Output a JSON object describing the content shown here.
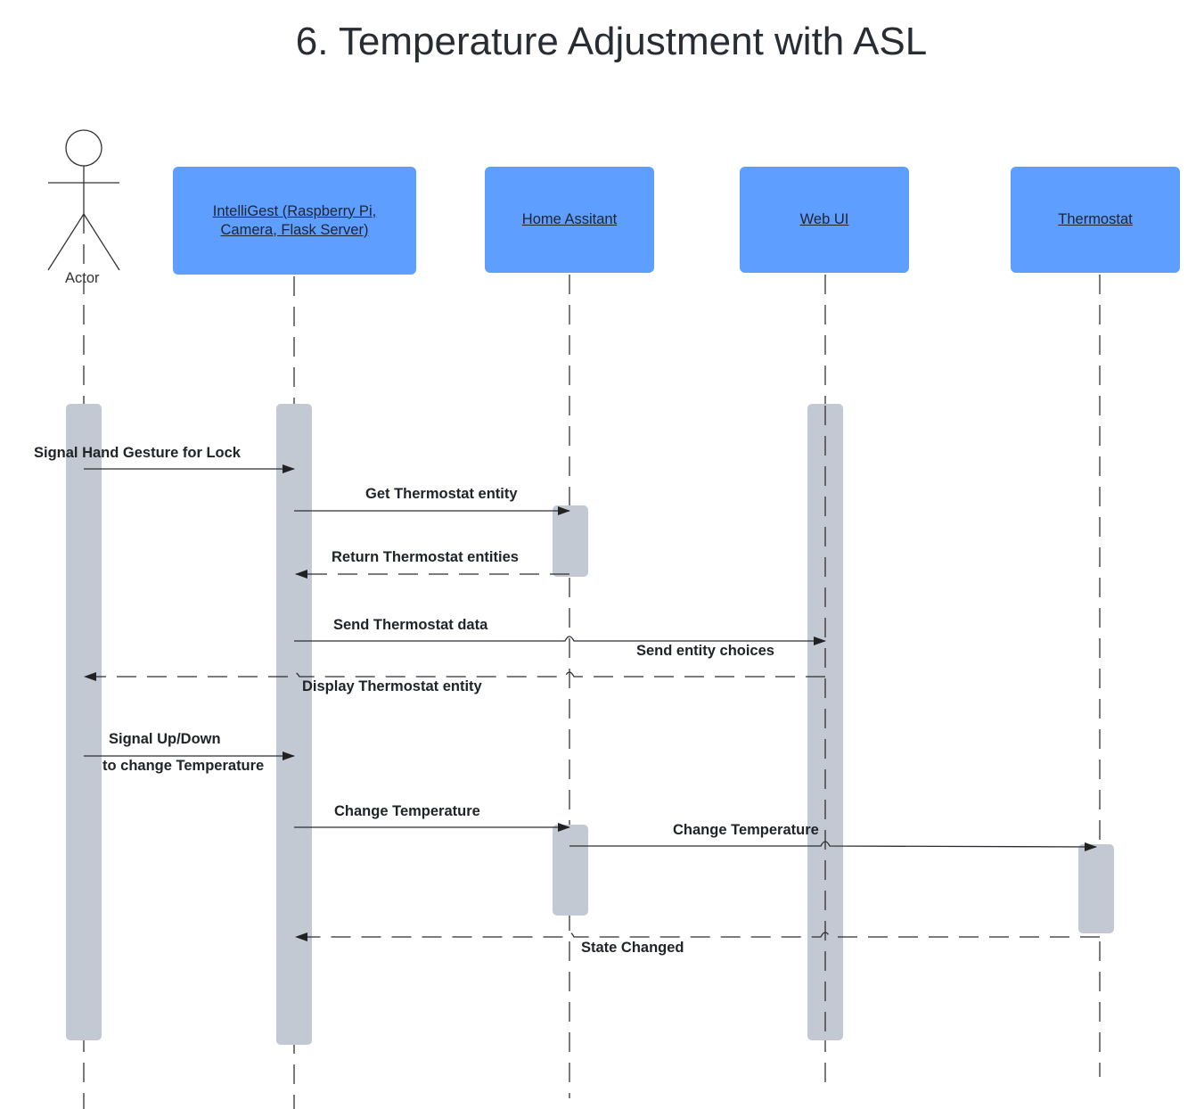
{
  "title": "6. Temperature Adjustment with ASL",
  "actor": {
    "label": "Actor",
    "icon": "stick-figure-icon"
  },
  "participants": [
    {
      "id": "intelligest",
      "label_lines": [
        "IntelliGest (Raspberry Pi,",
        "Camera, Flask Server)"
      ]
    },
    {
      "id": "home_assistant",
      "label_lines": [
        "Home Assitant"
      ]
    },
    {
      "id": "web_ui",
      "label_lines": [
        "Web UI"
      ]
    },
    {
      "id": "thermostat",
      "label_lines": [
        "Thermostat"
      ]
    }
  ],
  "messages": [
    {
      "from": "actor",
      "to": "intelligest",
      "type": "sync",
      "label": "Signal Hand Gesture for Lock"
    },
    {
      "from": "intelligest",
      "to": "home_assistant",
      "type": "sync",
      "label": "Get Thermostat entity"
    },
    {
      "from": "home_assistant",
      "to": "intelligest",
      "type": "return",
      "label": "Return Thermostat entities"
    },
    {
      "from": "intelligest",
      "to": "web_ui",
      "type": "sync",
      "label": "Send Thermostat data"
    },
    {
      "from": "web_ui",
      "to": "actor",
      "type": "return",
      "label": "Send entity choices"
    },
    {
      "from": "web_ui",
      "to": "actor",
      "type": "return",
      "label": "Display Thermostat entity"
    },
    {
      "from": "actor",
      "to": "intelligest",
      "type": "sync",
      "label_lines": [
        "Signal Up/Down",
        "to change Temperature"
      ]
    },
    {
      "from": "intelligest",
      "to": "home_assistant",
      "type": "sync",
      "label": "Change Temperature"
    },
    {
      "from": "home_assistant",
      "to": "thermostat",
      "type": "sync",
      "label": "Change Temperature"
    },
    {
      "from": "thermostat",
      "to": "intelligest",
      "type": "return",
      "label": "State Changed"
    }
  ],
  "colors": {
    "participant_fill": "#5e9eff",
    "activation_fill": "#c3c9d3",
    "line": "#2a2d33"
  }
}
